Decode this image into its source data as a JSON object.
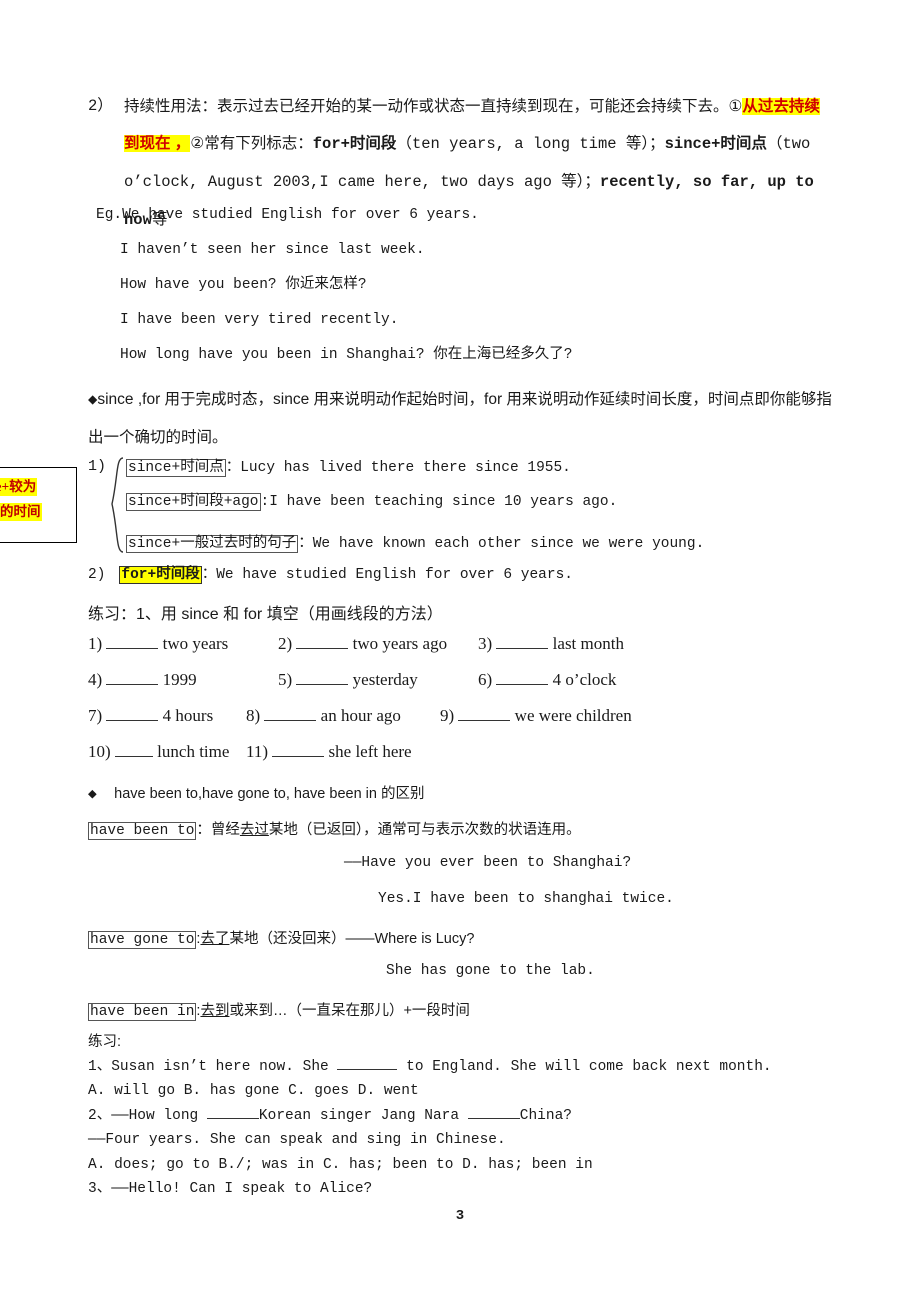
{
  "document": {
    "page_number": "3"
  },
  "section_continuous": {
    "index": "2）",
    "text_part1": "持续性用法：表示过去已经开始的某一动作或状态一直持续到现在，可能还会持续下去。①",
    "highlight1": "从过去",
    "highlight2": "持续到现在 ，",
    "text_part2": "②常有下列标志：",
    "marker_for": "for+时间段",
    "paren_for": "（ten years, a long time 等）；",
    "marker_since": "since+时间点",
    "paren_since": "（two o’clock, August 2003,I came here, two days ago 等）；",
    "markers_tail": "recently, so far, up to now",
    "tail_cn": "等"
  },
  "examples": {
    "lines": [
      "Eg.We have studied English for over 6 years.",
      "I haven’t seen her since last week.",
      "How have you been?  你近来怎样?",
      "I have been very tired recently.",
      "How long have you been in Shanghai?  你在上海已经多久了?"
    ]
  },
  "since_for_note": {
    "bullet": "◆",
    "text": "since ,for 用于完成时态，since 用来说明动作起始时间，for 用来说明动作延续时间长度，时间点即你能够指出一个确切的时间。"
  },
  "callout": {
    "line1": "since+较为",
    "line2": "具体的时间"
  },
  "group1": {
    "number": "1)",
    "items": [
      {
        "label": "since+时间点",
        "sep": "：",
        "example": "Lucy has lived there there since 1955."
      },
      {
        "label": "since+时间段+ago",
        "sep": ":",
        "example": "I have been teaching since 10 years ago."
      },
      {
        "label": "since+一般过去时的句子",
        "sep": "：",
        "example": "We have known each other since we were young."
      }
    ]
  },
  "group2": {
    "number": "2)",
    "label": "for+时间段",
    "sep": "：",
    "example": "We have studied English for over 6 years."
  },
  "practice1": {
    "title": "练习：1、用 since 和 for 填空（用画线段的方法）",
    "rows": [
      [
        {
          "num": "1)",
          "text": "two years"
        },
        {
          "num": "2)",
          "text": "two years ago"
        },
        {
          "num": "3)",
          "text": "last month"
        }
      ],
      [
        {
          "num": "4)",
          "text": "1999"
        },
        {
          "num": "5)",
          "text": "yesterday"
        },
        {
          "num": "6)",
          "text": "4 o’clock"
        }
      ],
      [
        {
          "num": "7)",
          "text": "4 hours"
        },
        {
          "num": "8)",
          "text": "an hour ago"
        },
        {
          "num": "9)",
          "text": "we were children"
        }
      ],
      [
        {
          "num": "10)",
          "text": "lunch time"
        },
        {
          "num": "11)",
          "text": "she left here"
        }
      ]
    ]
  },
  "distinction": {
    "bullet": "◆",
    "heading": "have been to,have gone to, have been in 的区别",
    "entries": [
      {
        "term": "have been to",
        "sep": "：",
        "meaning_underline": "去过",
        "meaning_rest": "曾经",
        "meaning_tail": "某地（已返回），通常可与表示次数的状语连用。",
        "example1": "——Have you ever been to Shanghai?",
        "example2": "Yes.I have been to shanghai twice."
      },
      {
        "term": "have gone to",
        "sep": ":",
        "meaning_underline": "去了",
        "meaning_tail": "某地（还没回来）——Where is Lucy?",
        "example1": "She has gone to the lab."
      },
      {
        "term": "have been in",
        "sep": ":",
        "meaning_underline": "去到",
        "meaning_tail": "或来到…（一直呆在那儿）+一段时间"
      }
    ]
  },
  "practice2": {
    "title": "练习:",
    "q1": {
      "text_before": "1、Susan isn’t here now. She",
      "text_after": "to England. She will come back next month.",
      "options": "A. will go     B. has gone    C. goes     D. went"
    },
    "q2": {
      "text_before": "2、——How long",
      "text_mid": "Korean singer Jang Nara",
      "text_after": "China?",
      "answer_line": "——Four years. She can speak and sing in Chinese.",
      "options": "A. does; go to  B./; was in   C. has; been to   D. has; been in"
    },
    "q3": {
      "text": "3、——Hello! Can I speak to Alice?"
    }
  }
}
